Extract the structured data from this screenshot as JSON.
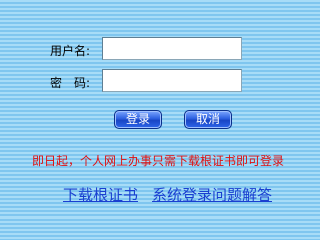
{
  "login": {
    "username_label": "用户名:",
    "password_label_a": "密",
    "password_label_b": "码:",
    "username_value": "",
    "password_value": ""
  },
  "buttons": {
    "login": "登录",
    "cancel": "取消"
  },
  "notice": "即日起，个人网上办事只需下载根证书即可登录",
  "links": {
    "download_cert": "下载根证书",
    "login_faq": "系统登录问题解答"
  },
  "colors": {
    "notice": "#e01010",
    "link": "#1a3fd0",
    "button": "#2b5fe0",
    "background": "#8fd0f2"
  }
}
